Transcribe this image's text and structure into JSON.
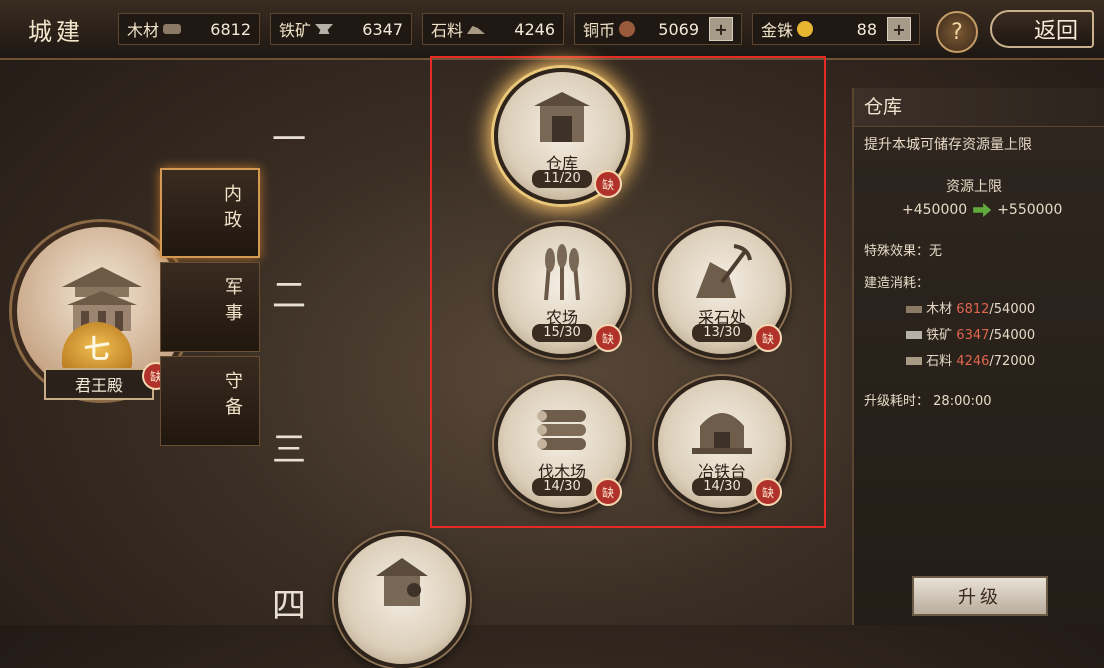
{
  "header": {
    "title": "城建",
    "help_label": "?",
    "back_label": "返回",
    "resources": [
      {
        "name": "木材",
        "icon": "wood-icon",
        "value": "6812",
        "has_plus": false
      },
      {
        "name": "铁矿",
        "icon": "iron-icon",
        "value": "6347",
        "has_plus": false
      },
      {
        "name": "石料",
        "icon": "stone-icon",
        "value": "4246",
        "has_plus": false
      },
      {
        "name": "铜币",
        "icon": "copper-coin-icon",
        "value": "5069",
        "has_plus": true
      },
      {
        "name": "金铢",
        "icon": "gold-coin-icon",
        "value": "88",
        "has_plus": true
      }
    ],
    "plus_label": "+"
  },
  "left": {
    "hall_name": "君王殿",
    "hall_level": "七",
    "lack_label": "缺",
    "tabs": [
      {
        "label": "内政",
        "active": true
      },
      {
        "label": "军事",
        "active": false
      },
      {
        "label": "守备",
        "active": false
      }
    ],
    "row_numbers": [
      "一",
      "二",
      "三",
      "四"
    ]
  },
  "buildings": [
    {
      "name": "仓库",
      "count": "11/20",
      "selected": true,
      "lack": true
    },
    {
      "name": "农场",
      "count": "15/30",
      "selected": false,
      "lack": true
    },
    {
      "name": "采石处",
      "count": "13/30",
      "selected": false,
      "lack": true
    },
    {
      "name": "伐木场",
      "count": "14/30",
      "selected": false,
      "lack": true
    },
    {
      "name": "冶铁台",
      "count": "14/30",
      "selected": false,
      "lack": true
    }
  ],
  "partial_building": {
    "icon": "lodge-icon"
  },
  "panel": {
    "title": "仓库",
    "description": "提升本城可储存资源量上限",
    "cap_label": "资源上限",
    "cap_from": "+450000",
    "cap_to": "+550000",
    "special_label": "特殊效果：无",
    "cost_label": "建造消耗：",
    "costs": [
      {
        "name": "木材",
        "have": "6812",
        "need": "/54000"
      },
      {
        "name": "铁矿",
        "have": "6347",
        "need": "/54000"
      },
      {
        "name": "石料",
        "have": "4246",
        "need": "/72000"
      }
    ],
    "time_label": "升级耗时：",
    "time_value": "28:00:00",
    "upgrade_label": "升级"
  },
  "colors": {
    "highlight_border": "#e42b26",
    "lack_red": "#b1322b",
    "insufficient": "#e0664e"
  }
}
